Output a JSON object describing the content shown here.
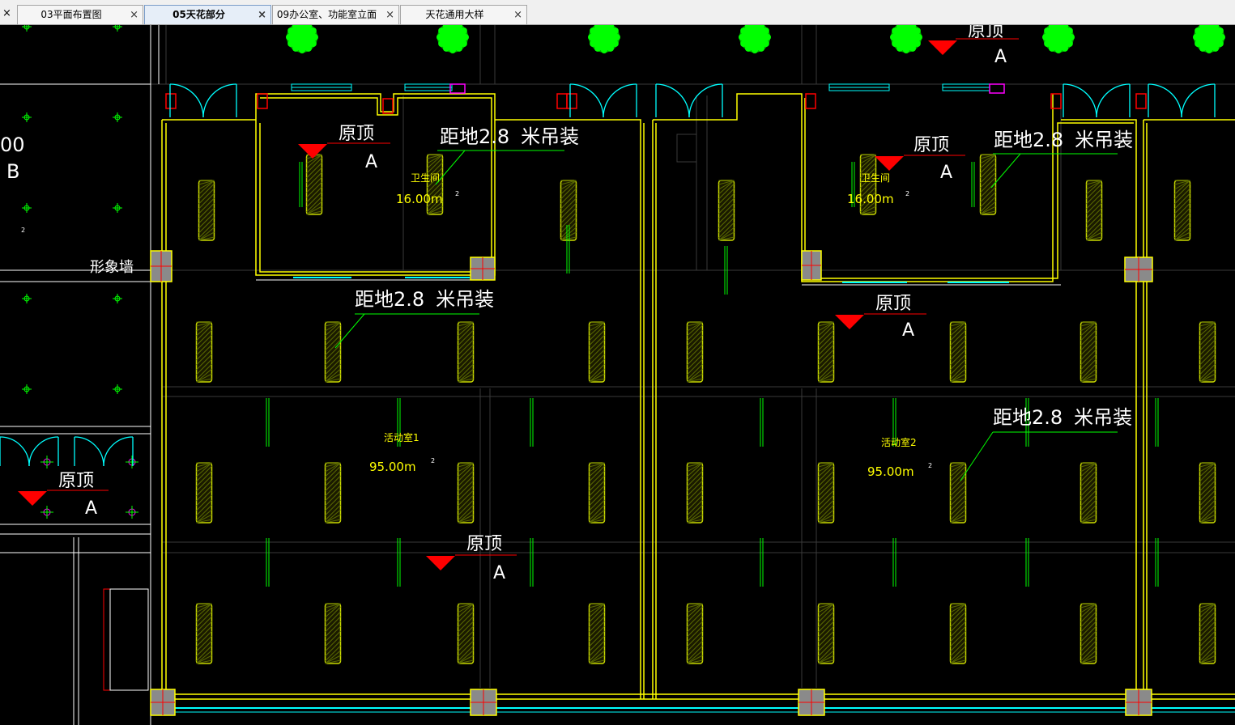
{
  "tabs": [
    {
      "label": "03平面布置图",
      "active": false
    },
    {
      "label": "05天花部分",
      "active": true
    },
    {
      "label": "09办公室、功能室立面",
      "active": false
    },
    {
      "label": "天花通用大样",
      "active": false
    }
  ],
  "close_glyph": "×",
  "drawing": {
    "left_area": {
      "label_00": "00",
      "label_B": "B",
      "feature_wall": "形象墙",
      "note_2": "2"
    },
    "ceiling_original": "原顶",
    "ceiling_type": "A",
    "hanging_note_pre": "距地",
    "hanging_note_value": "2.8",
    "hanging_note_post": "米吊装",
    "area_unit_sup": "2",
    "rooms": [
      {
        "name": "卫生间",
        "area": "16.00m"
      },
      {
        "name": "卫生间",
        "area": "16.00m"
      },
      {
        "name": "活动室1",
        "area": "95.00m"
      },
      {
        "name": "活动室2",
        "area": "95.00m"
      }
    ]
  },
  "colors": {
    "background": "#000000",
    "wall": "#ffff00",
    "light": "#c8d800",
    "green": "#00ff00",
    "cyan": "#00ffff",
    "red": "#ff0000",
    "magenta": "#ff00ff",
    "grid": "#3a3a3a",
    "white": "#ffffff"
  }
}
